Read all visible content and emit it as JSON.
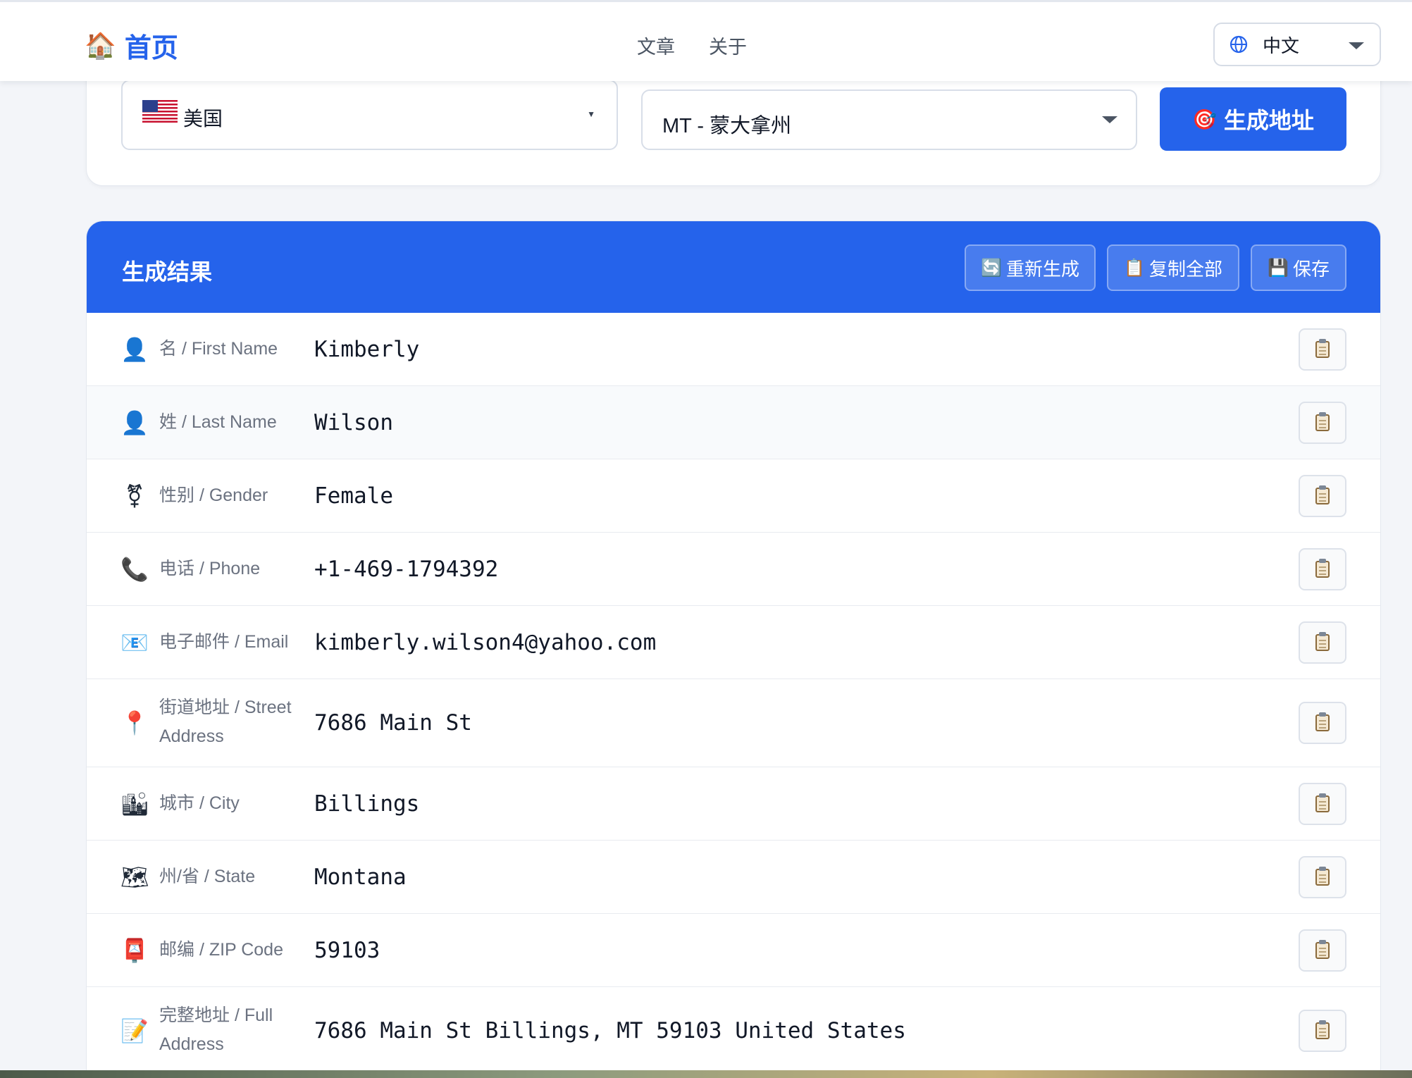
{
  "navbar": {
    "brand_icon": "house-emoji",
    "brand_label": "首页",
    "links": [
      "文章",
      "关于"
    ],
    "language": {
      "icon": "globe-icon",
      "label": "中文"
    }
  },
  "selector": {
    "country": {
      "flag": "us-flag-icon",
      "label": "美国"
    },
    "state": {
      "label": "MT - 蒙大拿州"
    },
    "generate_button": {
      "icon": "dart-icon",
      "label": "生成地址"
    }
  },
  "results": {
    "title": "生成结果",
    "buttons": [
      {
        "icon": "🔄",
        "label": "重新生成"
      },
      {
        "icon": "📋",
        "label": "复制全部"
      },
      {
        "icon": "💾",
        "label": "保存"
      }
    ],
    "rows": [
      {
        "icon": "👤",
        "label": "名 / First Name",
        "value": "Kimberly"
      },
      {
        "icon": "👤",
        "label": "姓 / Last Name",
        "value": "Wilson"
      },
      {
        "icon": "⚧",
        "label": "性别 / Gender",
        "value": "Female"
      },
      {
        "icon": "📞",
        "label": "电话 / Phone",
        "value": "+1-469-1794392"
      },
      {
        "icon": "📧",
        "label": "电子邮件 / Email",
        "value": "kimberly.wilson4@yahoo.com"
      },
      {
        "icon": "📍",
        "label": "街道地址 / Street Address",
        "value": "7686 Main St"
      },
      {
        "icon": "🏙",
        "label": "城市 / City",
        "value": "Billings"
      },
      {
        "icon": "🗺",
        "label": "州/省 / State",
        "value": "Montana"
      },
      {
        "icon": "📮",
        "label": "邮编 / ZIP Code",
        "value": "59103"
      },
      {
        "icon": "📝",
        "label": "完整地址 / Full Address",
        "value": "7686 Main St Billings, MT 59103 United States"
      }
    ]
  }
}
